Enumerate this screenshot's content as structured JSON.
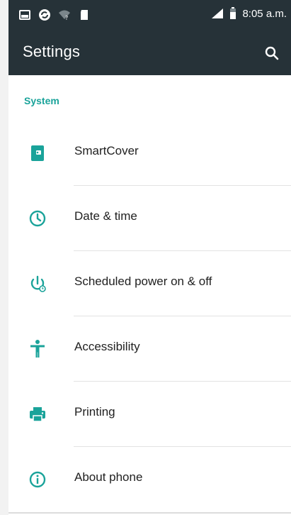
{
  "status_bar": {
    "time": "8:05 a.m.",
    "icons": [
      "gallery-icon",
      "sync-icon",
      "wifi-question-icon",
      "sd-card-icon",
      "signal-icon",
      "battery-icon"
    ]
  },
  "app_bar": {
    "title": "Settings",
    "search_icon": "search-icon"
  },
  "section": {
    "title": "System"
  },
  "items": [
    {
      "label": "SmartCover",
      "icon": "smartcover-icon"
    },
    {
      "label": "Date & time",
      "icon": "clock-icon"
    },
    {
      "label": "Scheduled power on & off",
      "icon": "power-timer-icon"
    },
    {
      "label": "Accessibility",
      "icon": "accessibility-icon"
    },
    {
      "label": "Printing",
      "icon": "printer-icon"
    },
    {
      "label": "About phone",
      "icon": "info-icon"
    }
  ],
  "colors": {
    "accent": "#1aa39a",
    "toolbar": "#263238"
  }
}
